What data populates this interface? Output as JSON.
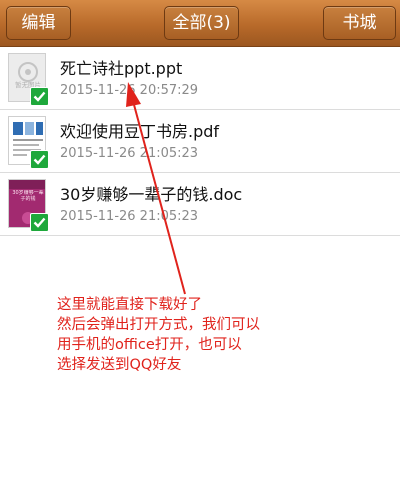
{
  "toolbar": {
    "edit_label": "编辑",
    "filter_label": "全部(3)",
    "store_label": "书城"
  },
  "files": [
    {
      "name": "死亡诗社ppt.ppt",
      "date": "2015-11-26 20:57:29",
      "cover_text": "暂无图片"
    },
    {
      "name": "欢迎使用豆丁书房.pdf",
      "date": "2015-11-26 21:05:23"
    },
    {
      "name": "30岁赚够一辈子的钱.doc",
      "date": "2015-11-26 21:05:23",
      "cover_text": "30岁赚够一辈子的钱"
    }
  ],
  "annotation": {
    "lines": [
      "这里就能直接下载好了",
      "然后会弹出打开方式，我们可以",
      "用手机的office打开，也可以",
      "选择发送到QQ好友"
    ],
    "color": "#e0231c"
  },
  "colors": {
    "toolbar": "#b86a2a",
    "check": "#1ea83b"
  }
}
